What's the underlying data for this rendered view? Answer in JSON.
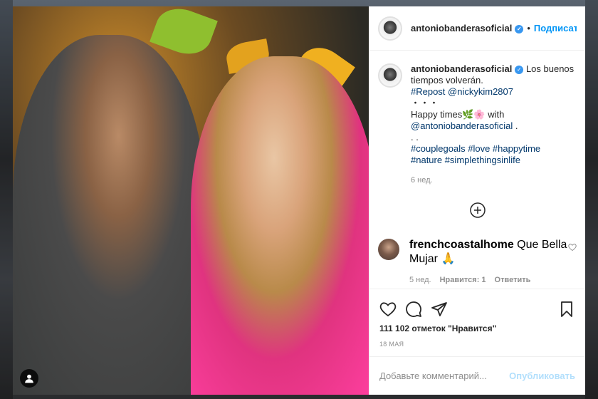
{
  "post": {
    "username": "antoniobanderasoficial",
    "verified_icon": "verified-badge-icon",
    "separator": "•",
    "follow_label": "Подписаться",
    "caption": {
      "text_after_name": "Los buenos tiempos volverán.",
      "repost_tag": "#Repost",
      "repost_user": "@nickykim2807",
      "dots1": "・・・",
      "happy_times": "Happy times",
      "emoji": "🌿🌸",
      "with_text": "with",
      "mention": "@antoniobanderasoficial",
      "period": ".",
      "dots2": ". .",
      "hashtags_line1": "#couplegoals #love #happytime",
      "hashtags_line2": "#nature #simplethingsinlife"
    },
    "caption_age": "6 нед."
  },
  "comments": [
    {
      "username": "frenchcoastalhome",
      "text": "Que Bella Mujar 🙏",
      "age": "5 нед.",
      "likes": "Нравится: 1",
      "reply": "Ответить"
    }
  ],
  "actions": {
    "likes_text": "111 102 отметок \"Нравится\"",
    "date": "18 МАЯ"
  },
  "add_comment": {
    "placeholder": "Добавьте комментарий...",
    "post_label": "Опубликовать"
  },
  "colors": {
    "accent": "#0095f6",
    "link": "#00376b",
    "muted": "#8e8e8e"
  }
}
